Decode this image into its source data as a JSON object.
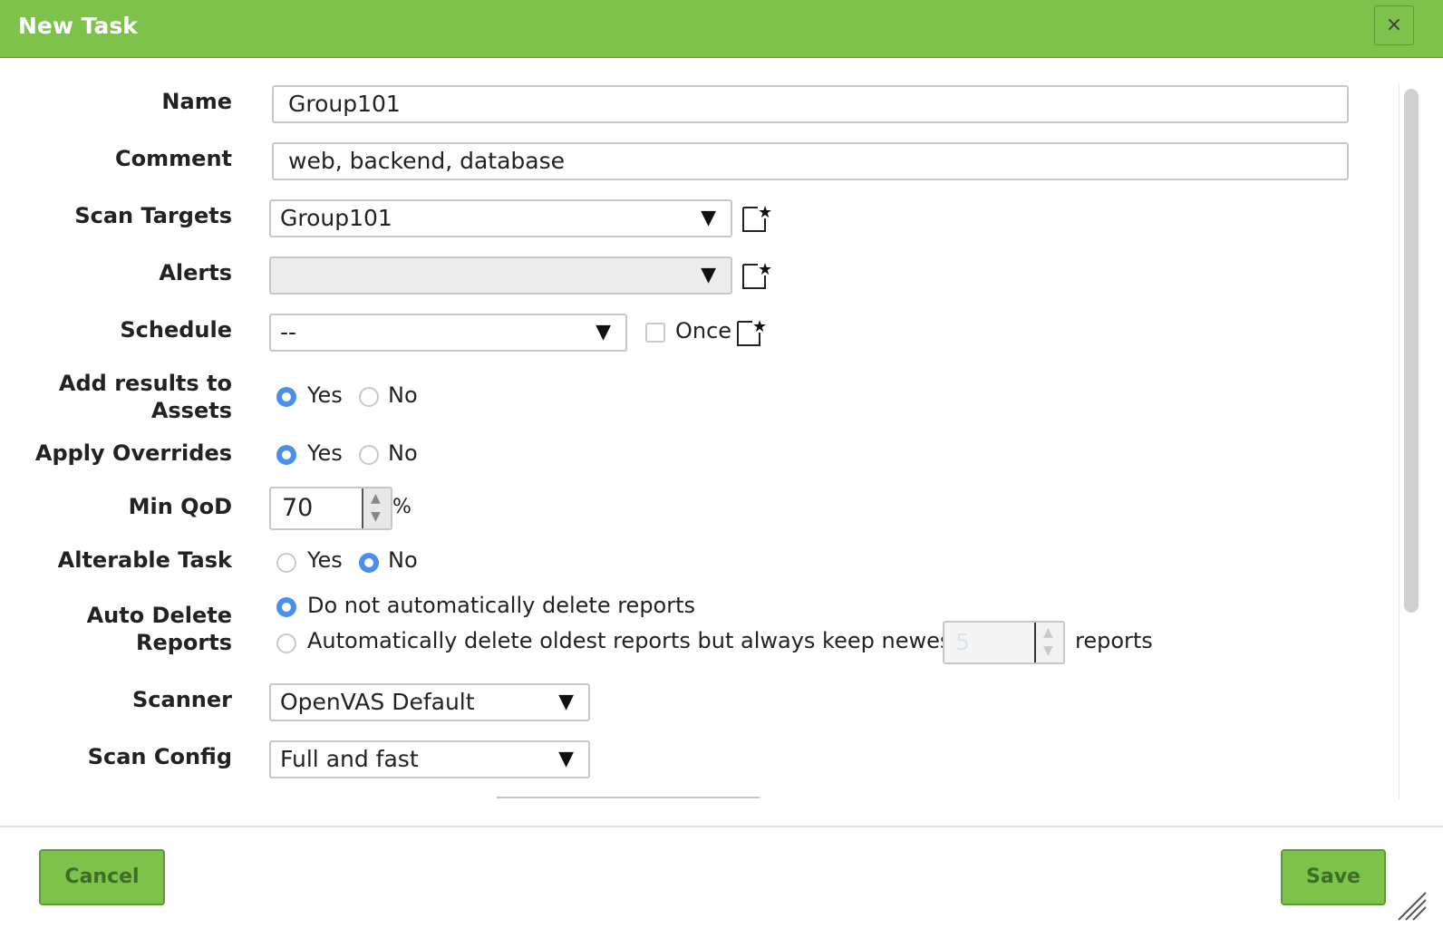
{
  "dialog": {
    "title": "New Task",
    "close_label": "×"
  },
  "form": {
    "name": {
      "label": "Name",
      "value": "Group101"
    },
    "comment": {
      "label": "Comment",
      "value": "web, backend, database"
    },
    "scan_targets": {
      "label": "Scan Targets",
      "value": "Group101"
    },
    "alerts": {
      "label": "Alerts",
      "value": ""
    },
    "schedule": {
      "label": "Schedule",
      "value": "--",
      "once_label": "Once",
      "once_checked": false
    },
    "add_results": {
      "label_line1": "Add results to",
      "label_line2": "Assets",
      "yes": "Yes",
      "no": "No",
      "selected": "Yes"
    },
    "apply_overrides": {
      "label": "Apply Overrides",
      "yes": "Yes",
      "no": "No",
      "selected": "Yes"
    },
    "min_qod": {
      "label": "Min QoD",
      "value": "70",
      "unit": "%"
    },
    "alterable": {
      "label": "Alterable Task",
      "yes": "Yes",
      "no": "No",
      "selected": "No"
    },
    "auto_delete": {
      "label_line1": "Auto Delete",
      "label_line2": "Reports",
      "option1": "Do not automatically delete reports",
      "option2": "Automatically delete oldest reports but always keep newest",
      "keep_value": "5",
      "suffix": "reports",
      "selected": "option1"
    },
    "scanner": {
      "label": "Scanner",
      "value": "OpenVAS Default"
    },
    "scan_config": {
      "label": "Scan Config",
      "value": "Full and fast"
    }
  },
  "footer": {
    "cancel_label": "Cancel",
    "save_label": "Save"
  }
}
